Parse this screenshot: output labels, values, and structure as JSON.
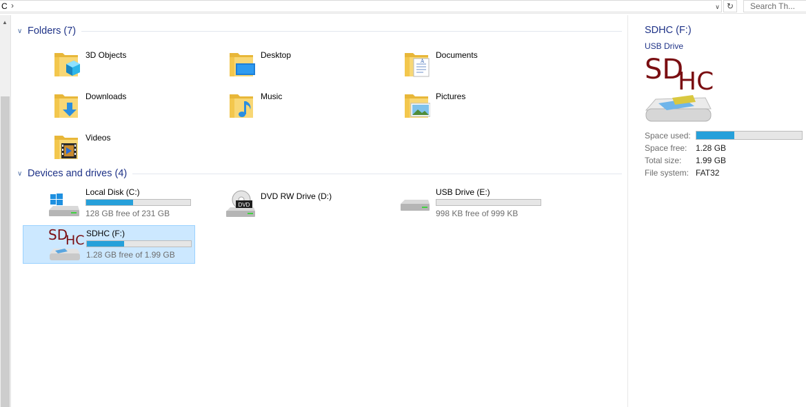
{
  "address_bar": {
    "path": "C",
    "chevron": "›",
    "dropdown_icon": "chevron-down-icon",
    "refresh_icon": "refresh-icon"
  },
  "search": {
    "placeholder": "Search Th..."
  },
  "groups": {
    "folders": {
      "title": "Folders (7)",
      "items": [
        {
          "label": "3D Objects",
          "icon": "3d-objects-folder-icon"
        },
        {
          "label": "Desktop",
          "icon": "desktop-folder-icon"
        },
        {
          "label": "Documents",
          "icon": "documents-folder-icon"
        },
        {
          "label": "Downloads",
          "icon": "downloads-folder-icon"
        },
        {
          "label": "Music",
          "icon": "music-folder-icon"
        },
        {
          "label": "Pictures",
          "icon": "pictures-folder-icon"
        },
        {
          "label": "Videos",
          "icon": "videos-folder-icon"
        }
      ]
    },
    "drives": {
      "title": "Devices and drives (4)",
      "items": [
        {
          "label": "Local Disk (C:)",
          "free_text": "128 GB free of 231 GB",
          "used_fraction": 0.45,
          "icon": "local-disk-icon"
        },
        {
          "label": "DVD RW Drive (D:)",
          "free_text": "",
          "icon": "dvd-drive-icon",
          "dvd_badge": "DVD"
        },
        {
          "label": "USB Drive (E:)",
          "free_text": "998 KB free of 999 KB",
          "used_fraction": 0.0,
          "icon": "usb-drive-icon"
        },
        {
          "label": "SDHC (F:)",
          "free_text": "1.28 GB free of 1.99 GB",
          "used_fraction": 0.36,
          "icon": "sdhc-drive-icon",
          "selected": true
        }
      ]
    }
  },
  "sdhc_logo": {
    "sd": "SD",
    "hc": "HC"
  },
  "details": {
    "title": "SDHC (F:)",
    "subtitle": "USB Drive",
    "space_used_label": "Space used:",
    "space_used_fraction": 0.36,
    "space_free_label": "Space free:",
    "space_free_value": "1.28 GB",
    "total_size_label": "Total size:",
    "total_size_value": "1.99 GB",
    "file_system_label": "File system:",
    "file_system_value": "FAT32"
  },
  "colors": {
    "accent": "#26a0da",
    "group_title": "#1e3287",
    "selection_bg": "#cce8ff",
    "selection_border": "#99d1ff",
    "folder_yellow": "#f8d775"
  }
}
